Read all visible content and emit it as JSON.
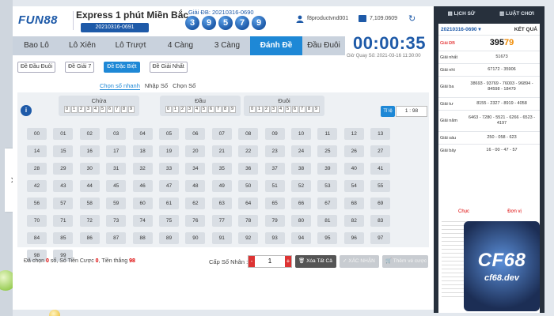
{
  "brand": "FUN88",
  "header": {
    "game_title": "Express 1 phút Miền Bắc",
    "game_id": "20210316-0691",
    "prize_label": "Giải ĐB: 20210316-0690",
    "prize_balls": [
      "3",
      "9",
      "5",
      "7",
      "9"
    ],
    "username": "f8productvnd001",
    "balance": "7,109.0609",
    "refresh_icon": "refresh-icon"
  },
  "tabs": [
    {
      "label": "Bao Lô",
      "active": false
    },
    {
      "label": "Lô Xiên",
      "active": false
    },
    {
      "label": "Lô Trượt",
      "active": false
    },
    {
      "label": "4 Càng",
      "active": false
    },
    {
      "label": "3 Càng",
      "active": false
    },
    {
      "label": "Đánh Đề",
      "active": true
    },
    {
      "label": "Đầu Đuôi",
      "active": false
    }
  ],
  "timer": {
    "value": "00:00:35",
    "draw_time": "Giờ Quay Số: 2021-03-16 11:30:00"
  },
  "subtabs": [
    {
      "label": "Đề Đầu Đuôi",
      "active": false
    },
    {
      "label": "Đề Giải 7",
      "active": false
    },
    {
      "label": "Đề Đặc Biệt",
      "active": true
    },
    {
      "label": "Đề Giải Nhất",
      "active": false
    }
  ],
  "modes": [
    {
      "label": "Chọn số nhanh",
      "active": true
    },
    {
      "label": "Nhập Số",
      "active": false
    },
    {
      "label": "Chọn Số",
      "active": false
    }
  ],
  "groups": [
    {
      "label": "Chửa",
      "digits": [
        "0",
        "1",
        "2",
        "3",
        "4",
        "5",
        "6",
        "7",
        "8",
        "9"
      ]
    },
    {
      "label": "Đầu",
      "digits": [
        "0",
        "1",
        "2",
        "3",
        "4",
        "5",
        "6",
        "7",
        "8",
        "9"
      ]
    },
    {
      "label": "Đuôi",
      "digits": [
        "0",
        "1",
        "2",
        "3",
        "4",
        "5",
        "6",
        "7",
        "8",
        "9"
      ]
    }
  ],
  "ratio": {
    "label": "Tỉ lệ",
    "value": "1 : 98"
  },
  "numbers": [
    "00",
    "01",
    "02",
    "03",
    "04",
    "05",
    "06",
    "07",
    "08",
    "09",
    "10",
    "11",
    "12",
    "13",
    "14",
    "15",
    "16",
    "17",
    "18",
    "19",
    "20",
    "21",
    "22",
    "23",
    "24",
    "25",
    "26",
    "27",
    "28",
    "29",
    "30",
    "31",
    "32",
    "33",
    "34",
    "35",
    "36",
    "37",
    "38",
    "39",
    "40",
    "41",
    "42",
    "43",
    "44",
    "45",
    "46",
    "47",
    "48",
    "49",
    "50",
    "51",
    "52",
    "53",
    "54",
    "55",
    "56",
    "57",
    "58",
    "59",
    "60",
    "61",
    "62",
    "63",
    "64",
    "65",
    "66",
    "67",
    "68",
    "69",
    "70",
    "71",
    "72",
    "73",
    "74",
    "75",
    "76",
    "77",
    "78",
    "79",
    "80",
    "81",
    "82",
    "83",
    "84",
    "85",
    "86",
    "87",
    "88",
    "89",
    "90",
    "91",
    "92",
    "93",
    "94",
    "95",
    "96",
    "97",
    "98",
    "99"
  ],
  "bottom": {
    "selected_prefix": "Đã chọn",
    "selected_value": "0",
    "selected_suffix": "số,",
    "stake_prefix": "Số Tiền Cược",
    "stake_value": "0",
    "win_prefix": ", Tiền thắng",
    "win_value": "98",
    "multiplier_label": "Cấp Số Nhân :",
    "multiplier_value": "1",
    "minus": "-",
    "plus": "+",
    "clear_all": "Xóa Tất Cả",
    "confirm": "XÁC NHẬN",
    "add_bet": "Thêm vé cược"
  },
  "right": {
    "history_tab": "LỊCH SỬ",
    "rules_tab": "LUẬT CHƠI",
    "result_id": "20210316-0690",
    "result_title": "KẾT QUẢ",
    "rows": [
      {
        "label": "Giải ĐB",
        "value_head": "395",
        "value_tail": "79"
      },
      {
        "label": "Giải nhất",
        "value": "51673"
      },
      {
        "label": "Giải nhì",
        "value": "67172 - 35906"
      },
      {
        "label": "Giải ba",
        "value": "38693 - 93769 - 76003 - 96894 - 84598 - 18479"
      },
      {
        "label": "Giải tư",
        "value": "8155 - 2327 - 8919 - 4058"
      },
      {
        "label": "Giải năm",
        "value": "6463 - 7280 - 5521 - 6266 - 6523 - 4197"
      },
      {
        "label": "Giải sáu",
        "value": "250 - 058 - 623"
      },
      {
        "label": "Giải bảy",
        "value": "16 - 00 - 47 - 57"
      }
    ],
    "bottom_head": [
      "Chục",
      "Đơn vị"
    ],
    "emblem_main": "CF68",
    "emblem_sub": "cf68.dev"
  }
}
